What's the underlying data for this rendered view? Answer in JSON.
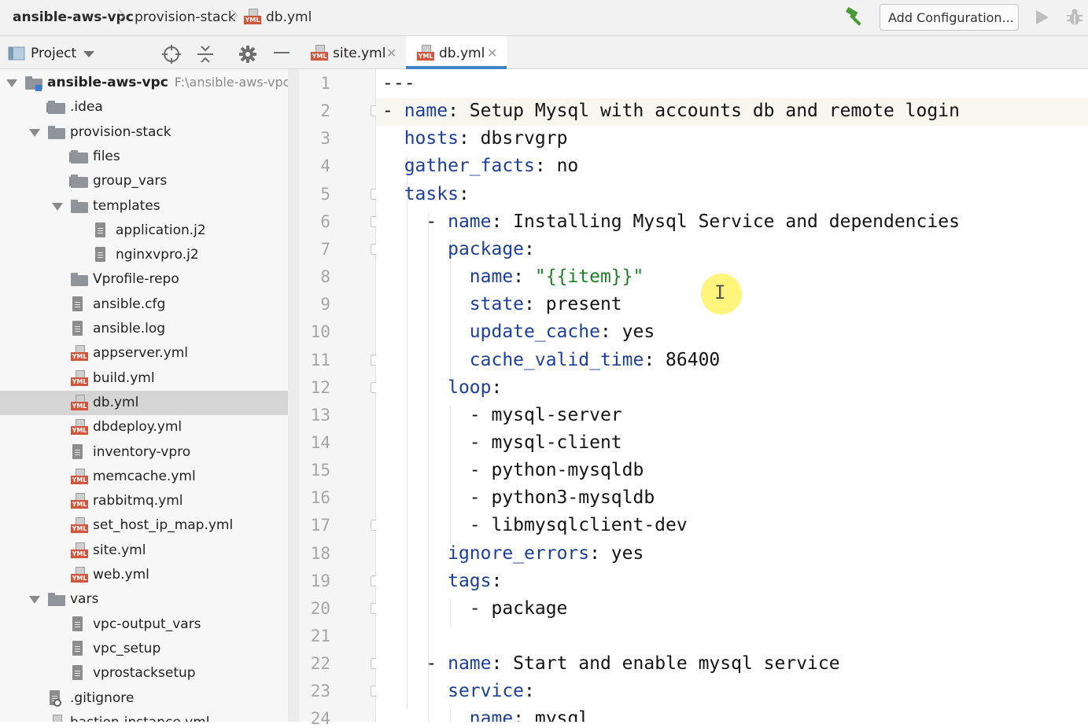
{
  "breadcrumb": {
    "root": "ansible-aws-vpc",
    "folder": "provision-stack",
    "file": "db.yml"
  },
  "toolbar": {
    "add_configuration_label": "Add Configuration..."
  },
  "project_panel": {
    "title": "Project"
  },
  "icons": {
    "yml_tag": "YML"
  },
  "tree": [
    {
      "label": "ansible-aws-vpc",
      "path": "F:\\ansible-aws-vpc",
      "type": "module",
      "depth": 0,
      "state": "expanded"
    },
    {
      "label": ".idea",
      "type": "folder",
      "depth": 1,
      "state": "collapsed"
    },
    {
      "label": "provision-stack",
      "type": "folder",
      "depth": 1,
      "state": "expanded"
    },
    {
      "label": "files",
      "type": "folder",
      "depth": 2,
      "state": "collapsed"
    },
    {
      "label": "group_vars",
      "type": "folder",
      "depth": 2,
      "state": "collapsed"
    },
    {
      "label": "templates",
      "type": "folder",
      "depth": 2,
      "state": "expanded"
    },
    {
      "label": "application.j2",
      "type": "text",
      "depth": 3
    },
    {
      "label": "nginxvpro.j2",
      "type": "text",
      "depth": 3
    },
    {
      "label": "Vprofile-repo",
      "type": "folder",
      "depth": 2
    },
    {
      "label": "ansible.cfg",
      "type": "text",
      "depth": 2
    },
    {
      "label": "ansible.log",
      "type": "text",
      "depth": 2
    },
    {
      "label": "appserver.yml",
      "type": "yml",
      "depth": 2
    },
    {
      "label": "build.yml",
      "type": "yml",
      "depth": 2
    },
    {
      "label": "db.yml",
      "type": "yml",
      "depth": 2,
      "selected": true
    },
    {
      "label": "dbdeploy.yml",
      "type": "yml",
      "depth": 2
    },
    {
      "label": "inventory-vpro",
      "type": "text",
      "depth": 2
    },
    {
      "label": "memcache.yml",
      "type": "yml",
      "depth": 2
    },
    {
      "label": "rabbitmq.yml",
      "type": "yml",
      "depth": 2
    },
    {
      "label": "set_host_ip_map.yml",
      "type": "yml",
      "depth": 2
    },
    {
      "label": "site.yml",
      "type": "yml",
      "depth": 2
    },
    {
      "label": "web.yml",
      "type": "yml",
      "depth": 2
    },
    {
      "label": "vars",
      "type": "folder",
      "depth": 1,
      "state": "expanded"
    },
    {
      "label": "vpc-output_vars",
      "type": "text",
      "depth": 2
    },
    {
      "label": "vpc_setup",
      "type": "text",
      "depth": 2
    },
    {
      "label": "vprostacksetup",
      "type": "text",
      "depth": 2
    },
    {
      "label": ".gitignore",
      "type": "gitignore",
      "depth": 1
    },
    {
      "label": "bastion-instance.yml",
      "type": "yml",
      "depth": 1
    }
  ],
  "tabs": [
    {
      "label": "site.yml",
      "active": false
    },
    {
      "label": "db.yml",
      "active": true
    }
  ],
  "editor": {
    "current_line": 2,
    "lines": [
      [
        [
          "p",
          "---"
        ]
      ],
      [
        [
          "p",
          "- "
        ],
        [
          "k",
          "name"
        ],
        [
          "p",
          ": Setup Mysql with accounts db and remote login"
        ]
      ],
      [
        [
          "p",
          "  "
        ],
        [
          "k",
          "hosts"
        ],
        [
          "p",
          ": dbsrvgrp"
        ]
      ],
      [
        [
          "p",
          "  "
        ],
        [
          "k",
          "gather_facts"
        ],
        [
          "p",
          ": no"
        ]
      ],
      [
        [
          "p",
          "  "
        ],
        [
          "k",
          "tasks"
        ],
        [
          "p",
          ":"
        ]
      ],
      [
        [
          "p",
          "    - "
        ],
        [
          "k",
          "name"
        ],
        [
          "p",
          ": Installing Mysql Service and dependencies"
        ]
      ],
      [
        [
          "p",
          "      "
        ],
        [
          "k",
          "package"
        ],
        [
          "p",
          ":"
        ]
      ],
      [
        [
          "p",
          "        "
        ],
        [
          "k",
          "name"
        ],
        [
          "p",
          ": "
        ],
        [
          "s",
          "\"{{item}}\""
        ]
      ],
      [
        [
          "p",
          "        "
        ],
        [
          "k",
          "state"
        ],
        [
          "p",
          ": present"
        ]
      ],
      [
        [
          "p",
          "        "
        ],
        [
          "k",
          "update_cache"
        ],
        [
          "p",
          ": yes"
        ]
      ],
      [
        [
          "p",
          "        "
        ],
        [
          "k",
          "cache_valid_time"
        ],
        [
          "p",
          ": 86400"
        ]
      ],
      [
        [
          "p",
          "      "
        ],
        [
          "k",
          "loop"
        ],
        [
          "p",
          ":"
        ]
      ],
      [
        [
          "p",
          "        - mysql-server"
        ]
      ],
      [
        [
          "p",
          "        - mysql-client"
        ]
      ],
      [
        [
          "p",
          "        - python-mysqldb"
        ]
      ],
      [
        [
          "p",
          "        - python3-mysqldb"
        ]
      ],
      [
        [
          "p",
          "        - libmysqlclient-dev"
        ]
      ],
      [
        [
          "p",
          "      "
        ],
        [
          "k",
          "ignore_errors"
        ],
        [
          "p",
          ": yes"
        ]
      ],
      [
        [
          "p",
          "      "
        ],
        [
          "k",
          "tags"
        ],
        [
          "p",
          ":"
        ]
      ],
      [
        [
          "p",
          "        - package"
        ]
      ],
      [
        [
          "p",
          ""
        ]
      ],
      [
        [
          "p",
          "    - "
        ],
        [
          "k",
          "name"
        ],
        [
          "p",
          ": Start and enable mysql service"
        ]
      ],
      [
        [
          "p",
          "      "
        ],
        [
          "k",
          "service"
        ],
        [
          "p",
          ":"
        ]
      ],
      [
        [
          "p",
          "        "
        ],
        [
          "k",
          "name"
        ],
        [
          "p",
          ": mysql"
        ]
      ]
    ],
    "fold_markers": [
      2,
      5,
      6,
      7,
      11,
      12,
      17,
      19,
      20,
      22,
      23
    ],
    "cursor_glyph": "I"
  }
}
